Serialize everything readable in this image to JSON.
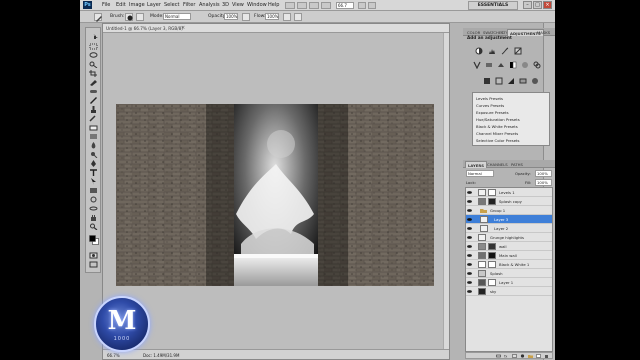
{
  "app": {
    "logo": "Ps",
    "menu": [
      "File",
      "Edit",
      "Image",
      "Layer",
      "Select",
      "Filter",
      "Analysis",
      "3D",
      "View",
      "Window",
      "Help"
    ],
    "zoom": "66.7",
    "workspace": "ESSENTIALS",
    "window_controls": [
      "–",
      "□",
      "×"
    ]
  },
  "options": {
    "brush_label": "Brush:",
    "brush_size": "",
    "mode_label": "Mode:",
    "mode_value": "Normal",
    "opacity_label": "Opacity:",
    "opacity_value": "100%",
    "flow_label": "Flow:",
    "flow_value": "100%"
  },
  "document": {
    "tab_title": "Untitled-1 @ 66.7% (Layer 3, RGB/8)",
    "tab_close": "×",
    "status_zoom": "66.7%",
    "status_doc": "Doc: 1.49M/31.9M"
  },
  "panels": {
    "top_tabs": [
      "COLOR",
      "SWATCHES",
      "STYLES",
      "ADJUSTMENTS",
      "MASKS"
    ],
    "adjustments_title": "Add an adjustment",
    "presets": [
      "Levels Presets",
      "Curves Presets",
      "Exposure Presets",
      "Hue/Saturation Presets",
      "Black & White Presets",
      "Channel Mixer Presets",
      "Selective Color Presets"
    ],
    "layer_tabs": [
      "LAYERS",
      "CHANNELS",
      "PATHS"
    ],
    "blend_mode": "Normal",
    "opacity_label": "Opacity:",
    "opacity_value": "100%",
    "lock_label": "Lock:",
    "fill_label": "Fill:",
    "fill_value": "100%",
    "layers": [
      {
        "name": "Levels 1"
      },
      {
        "name": "Splash copy"
      },
      {
        "name": "Group 1"
      },
      {
        "name": "Layer 3",
        "selected": true
      },
      {
        "name": "Layer 2"
      },
      {
        "name": "Grunge highlights"
      },
      {
        "name": "wall"
      },
      {
        "name": "Main wall"
      },
      {
        "name": "Black & White 1"
      },
      {
        "name": "Splash"
      },
      {
        "name": "Layer 1"
      },
      {
        "name": "sky"
      }
    ]
  },
  "watermark": {
    "letter": "M",
    "text": "1000"
  },
  "colors": {
    "accent": "#3e7fd8",
    "app_bg": "#b4b4b4",
    "logo_blue": "#2f4ba8"
  }
}
